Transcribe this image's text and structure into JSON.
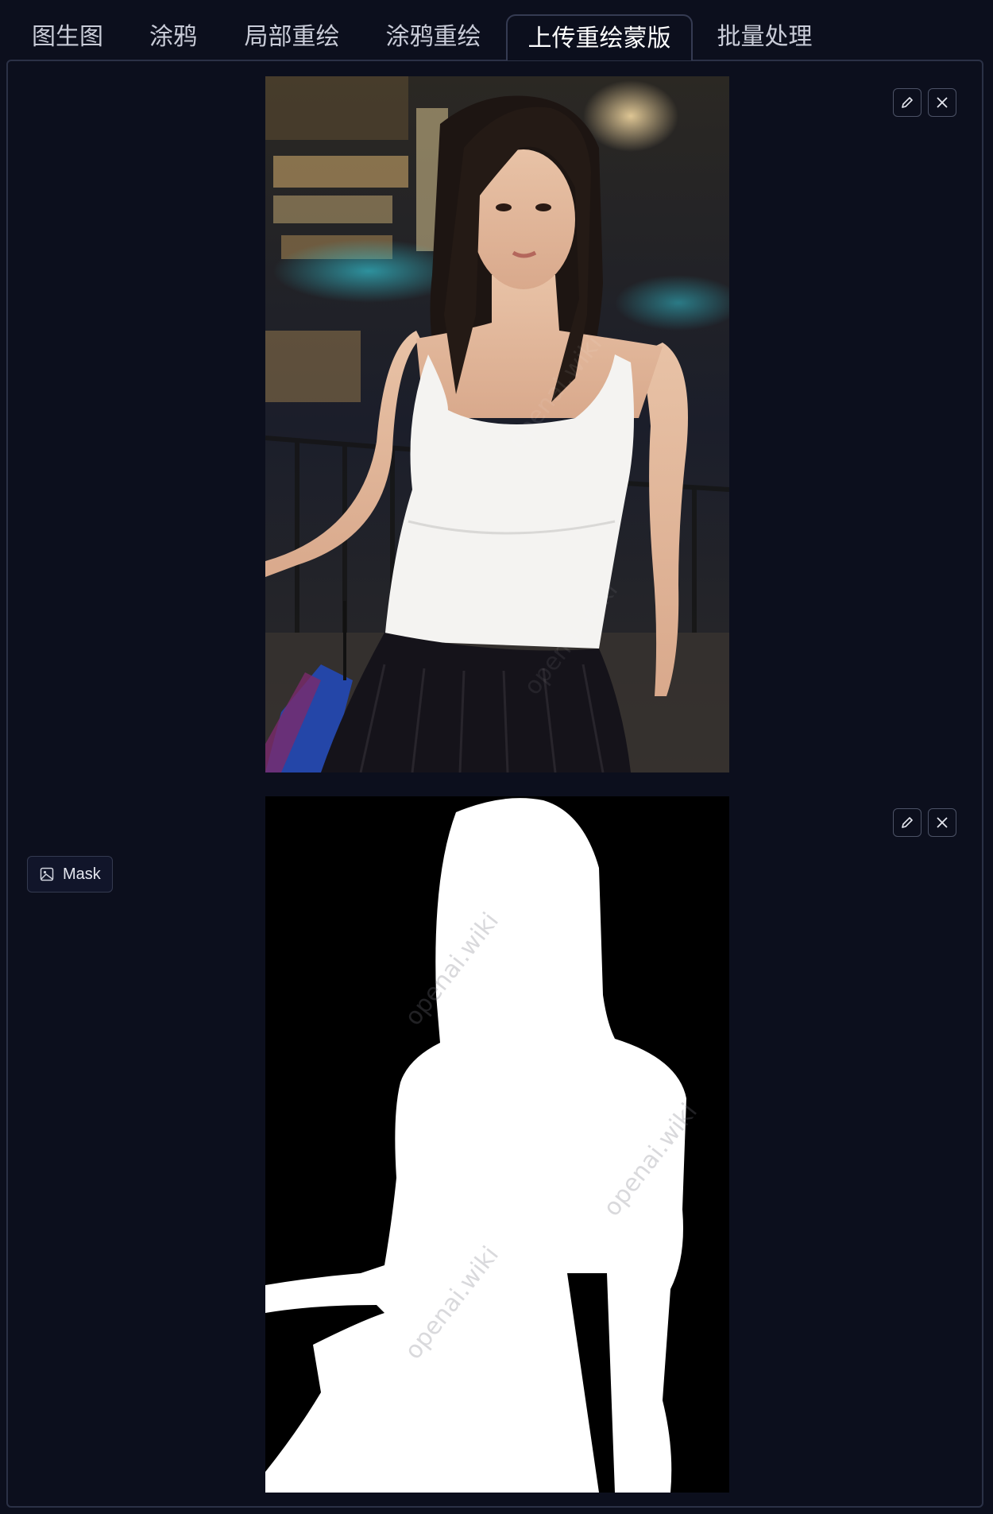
{
  "tabs": [
    {
      "label": "图生图",
      "active": false
    },
    {
      "label": "涂鸦",
      "active": false
    },
    {
      "label": "局部重绘",
      "active": false
    },
    {
      "label": "涂鸦重绘",
      "active": false
    },
    {
      "label": "上传重绘蒙版",
      "active": true
    },
    {
      "label": "批量处理",
      "active": false
    }
  ],
  "source_image": {
    "controls": {
      "edit_icon": "pencil-icon",
      "close_icon": "close-icon"
    }
  },
  "mask_image": {
    "label": "Mask",
    "label_icon": "image-icon",
    "controls": {
      "edit_icon": "pencil-icon",
      "close_icon": "close-icon"
    }
  },
  "watermark": "openai.wiki",
  "colors": {
    "background": "#0c0f1d",
    "border": "#2b3146",
    "active_tab_text": "#ffffff",
    "tab_text": "#c9ccd8"
  }
}
